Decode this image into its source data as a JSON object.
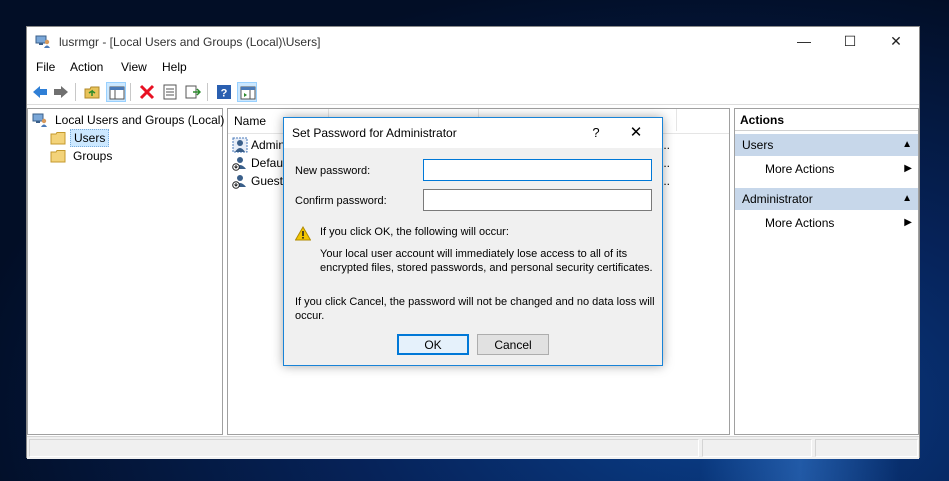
{
  "window": {
    "title": "lusrmgr - [Local Users and Groups (Local)\\Users]",
    "controls": {
      "minimize": "—",
      "maximize": "☐",
      "close": "✕"
    }
  },
  "menubar": [
    "File",
    "Action",
    "View",
    "Help"
  ],
  "toolbar": {
    "icons": [
      "back-arrow-icon",
      "forward-arrow-icon",
      "up-folder-icon",
      "show-hide-tree-icon",
      "delete-icon",
      "properties-icon",
      "export-list-icon",
      "help-icon",
      "show-hide-action-pane-icon"
    ]
  },
  "tree": {
    "root": "Local Users and Groups (Local)",
    "items": [
      "Users",
      "Groups"
    ],
    "selected": "Users"
  },
  "list": {
    "columns": [
      "Name"
    ],
    "rows": [
      {
        "name": "Admin",
        "ellipsis": "..."
      },
      {
        "name": "Defaul",
        "ellipsis": "..."
      },
      {
        "name": "Guest",
        "ellipsis": "..."
      }
    ]
  },
  "actions": {
    "title": "Actions",
    "groups": [
      {
        "name": "Users",
        "caret": "▲",
        "items": [
          {
            "label": "More Actions",
            "arrow": "▶"
          }
        ]
      },
      {
        "name": "Administrator",
        "caret": "▲",
        "items": [
          {
            "label": "More Actions",
            "arrow": "▶"
          }
        ]
      }
    ]
  },
  "dialog": {
    "title": "Set Password for Administrator",
    "help": "?",
    "close": "✕",
    "new_password_label": "New password:",
    "new_password_value": "",
    "confirm_password_label": "Confirm password:",
    "confirm_password_value": "",
    "warning_heading": "If you click OK, the following will occur:",
    "warning_body_1": "Your local user account will immediately lose access to all of its",
    "warning_body_2": "encrypted files, stored passwords, and personal security certificates.",
    "cancel_note_1": "If you click Cancel, the password will not be changed and no data loss will",
    "cancel_note_2": "occur.",
    "ok_label": "OK",
    "cancel_label": "Cancel"
  },
  "colors": {
    "selection": "#cce8ff",
    "action_group_bg": "#c7d7ea",
    "dialog_border": "#1883d7",
    "focus_border": "#0078d7",
    "delete_red": "#e81123",
    "warning_yellow": "#f2c500"
  }
}
